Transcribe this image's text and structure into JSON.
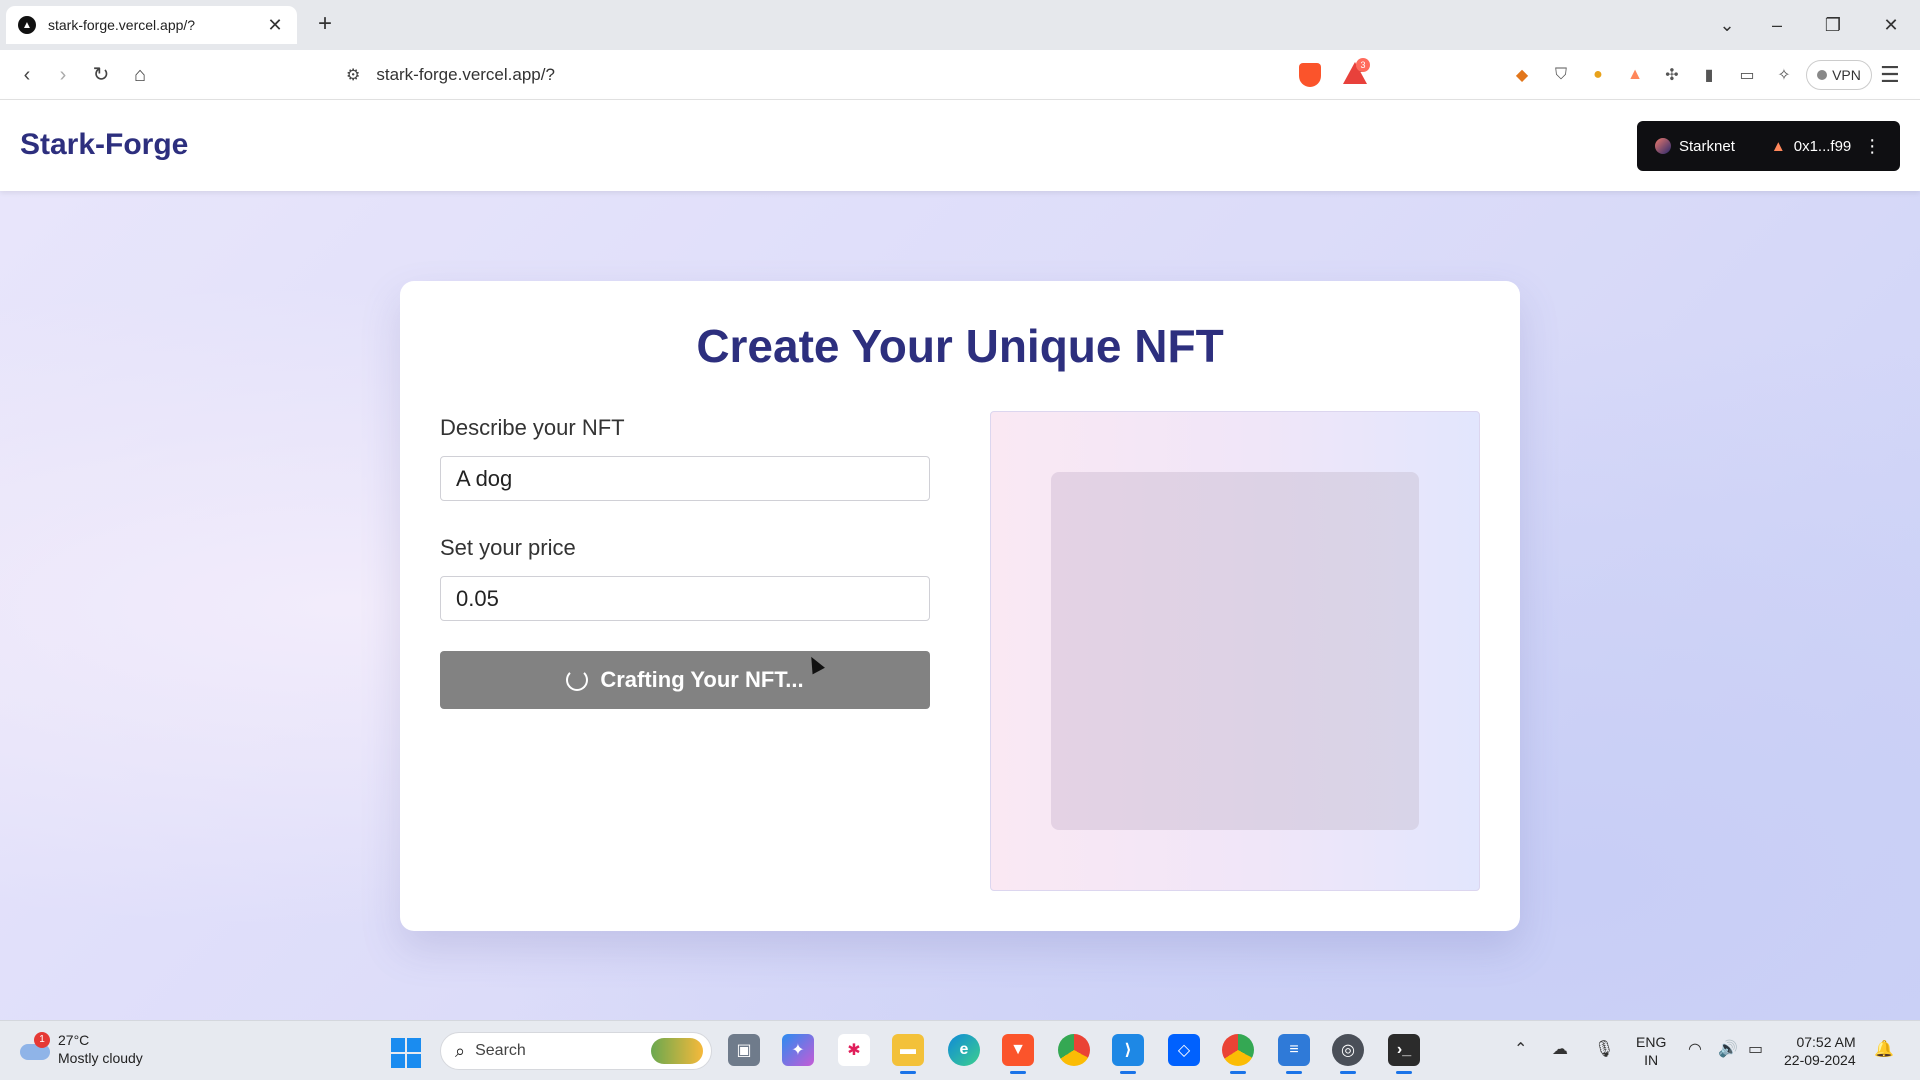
{
  "browser": {
    "tab_title": "stark-forge.vercel.app/?",
    "tab_close": "✕",
    "new_tab": "+",
    "url": "stark-forge.vercel.app/?",
    "rewards_count": "3",
    "vpn_label": "VPN"
  },
  "header": {
    "brand": "Stark-Forge",
    "wallet": {
      "network": "Starknet",
      "account": "0x1...f99"
    }
  },
  "form": {
    "title": "Create Your Unique NFT",
    "describe_label": "Describe your NFT",
    "describe_value": "A dog",
    "price_label": "Set your price",
    "price_value": "0.05",
    "submit_label": "Crafting Your NFT..."
  },
  "taskbar": {
    "weather_badge": "1",
    "temperature": "27°C",
    "condition": "Mostly cloudy",
    "search_placeholder": "Search",
    "lang_line1": "ENG",
    "lang_line2": "IN",
    "time": "07:52 AM",
    "date": "22-09-2024"
  },
  "colors": {
    "brand": "#2d2f7e",
    "button_loading": "#828282",
    "wallet_bg": "#0f0f12"
  }
}
